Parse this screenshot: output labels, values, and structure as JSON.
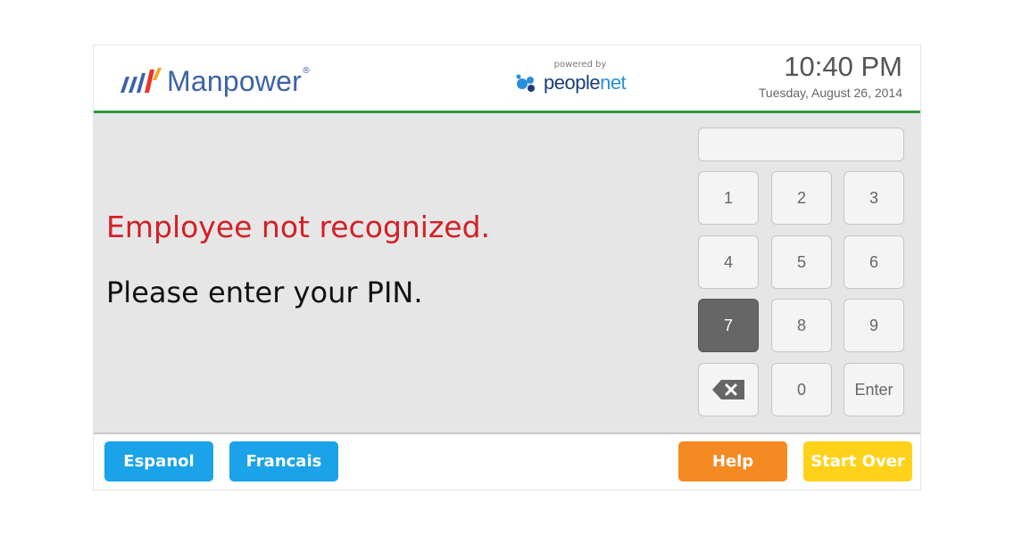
{
  "header": {
    "brand_name": "Manpower",
    "brand_reg": "®",
    "powered_by": "powered by",
    "partner_name_main": "people",
    "partner_name_accent": "net",
    "time": "10:40 PM",
    "date": "Tuesday, August 26, 2014",
    "accent_color": "#2e9a3a"
  },
  "main": {
    "error_message": "Employee not recognized.",
    "prompt_message": "Please enter your PIN.",
    "error_color": "#d32027",
    "pin_value": ""
  },
  "keypad": {
    "keys": [
      "1",
      "2",
      "3",
      "4",
      "5",
      "6",
      "7",
      "8",
      "9",
      "",
      "0",
      "Enter"
    ],
    "backspace_icon": "backspace-icon",
    "pressed_key": "7"
  },
  "footer": {
    "espanol_label": "Espanol",
    "francais_label": "Francais",
    "help_label": "Help",
    "start_over_label": "Start Over",
    "language_color": "#1aa3e8",
    "help_color": "#f58a23",
    "start_over_color": "#ffd21a"
  }
}
